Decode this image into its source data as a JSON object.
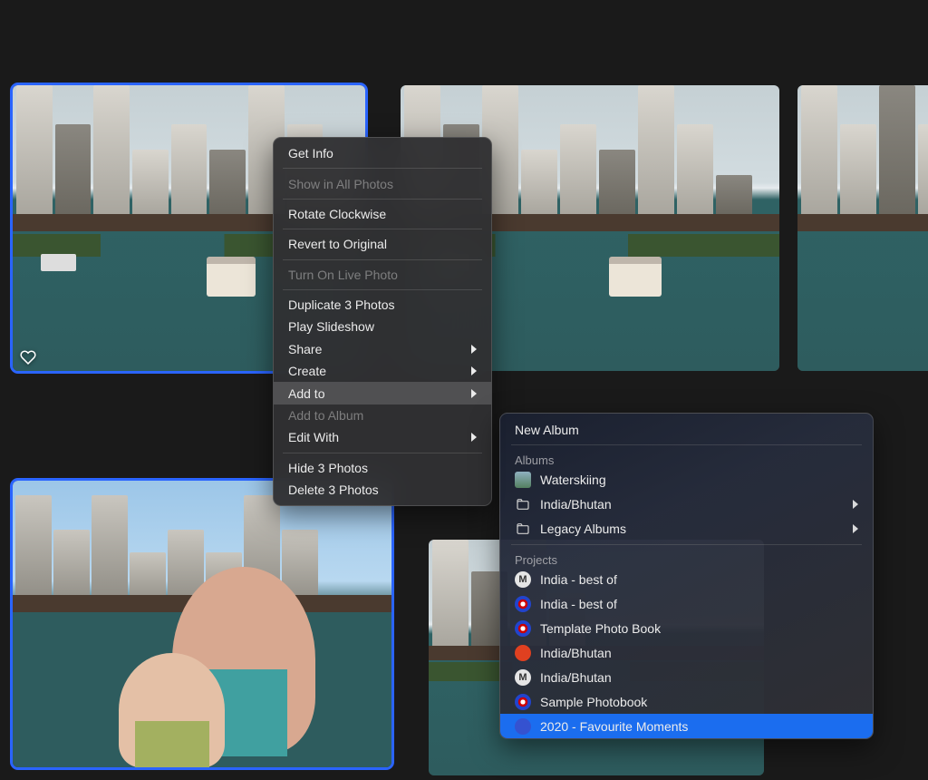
{
  "contextMenu": {
    "items": [
      {
        "label": "Get Info",
        "disabled": false,
        "submenu": false
      },
      {
        "sep": true
      },
      {
        "label": "Show in All Photos",
        "disabled": true,
        "submenu": false
      },
      {
        "sep": true
      },
      {
        "label": "Rotate Clockwise",
        "disabled": false,
        "submenu": false
      },
      {
        "sep": true
      },
      {
        "label": "Revert to Original",
        "disabled": false,
        "submenu": false
      },
      {
        "sep": true
      },
      {
        "label": "Turn On Live Photo",
        "disabled": true,
        "submenu": false
      },
      {
        "sep": true
      },
      {
        "label": "Duplicate 3 Photos",
        "disabled": false,
        "submenu": false
      },
      {
        "label": "Play Slideshow",
        "disabled": false,
        "submenu": false
      },
      {
        "label": "Share",
        "disabled": false,
        "submenu": true
      },
      {
        "label": "Create",
        "disabled": false,
        "submenu": true
      },
      {
        "label": "Add to",
        "disabled": false,
        "submenu": true,
        "highlight": true
      },
      {
        "label": "Add to Album",
        "disabled": true,
        "submenu": false
      },
      {
        "label": "Edit With",
        "disabled": false,
        "submenu": true
      },
      {
        "sep": true
      },
      {
        "label": "Hide 3 Photos",
        "disabled": false,
        "submenu": false
      },
      {
        "label": "Delete 3 Photos",
        "disabled": false,
        "submenu": false
      }
    ]
  },
  "submenu": {
    "newAlbum": "New Album",
    "albumsHeader": "Albums",
    "albums": [
      {
        "label": "Waterskiing",
        "icon": "thumb",
        "submenu": false
      },
      {
        "label": "India/Bhutan",
        "icon": "folder",
        "submenu": true
      },
      {
        "label": "Legacy Albums",
        "icon": "folder",
        "submenu": true
      }
    ],
    "projectsHeader": "Projects",
    "projects": [
      {
        "label": "India - best of",
        "icon": "m"
      },
      {
        "label": "India - best of",
        "icon": "us"
      },
      {
        "label": "Template Photo Book",
        "icon": "us"
      },
      {
        "label": "India/Bhutan",
        "icon": "red"
      },
      {
        "label": "India/Bhutan",
        "icon": "m"
      },
      {
        "label": "Sample Photobook",
        "icon": "us"
      },
      {
        "label": "2020 - Favourite Moments",
        "icon": "blue",
        "selected": true
      }
    ]
  }
}
